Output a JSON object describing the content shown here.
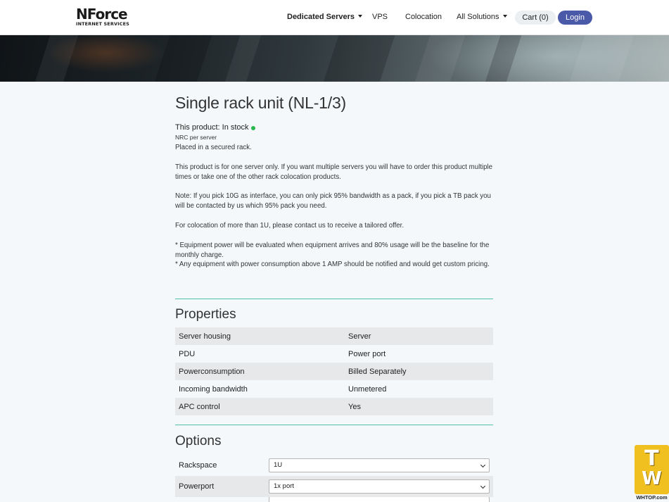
{
  "header": {
    "logo_main": "NForce",
    "logo_sub": "INTERNET SERVICES",
    "nav": [
      {
        "label": "Dedicated Servers",
        "has_dropdown": true
      },
      {
        "label": "VPS",
        "has_dropdown": false
      },
      {
        "label": "Colocation",
        "has_dropdown": false
      },
      {
        "label": "All Solutions",
        "has_dropdown": true
      }
    ],
    "cart_label": "Cart (0)",
    "login_label": "Login"
  },
  "product": {
    "title": "Single rack unit (NL-1/3)",
    "stock_label": "This product: In stock",
    "stock_status_color": "#28b84b",
    "nrc": "NRC per server",
    "paragraphs": [
      "Placed in a secured rack.",
      "This product is for one server only. If you want multiple servers you will have to order this product multiple times or take one of the other rack colocation products.",
      "Note: If you pick 10G as interface, you can only pick 95% bandwidth as a pack, if you pick a TB pack you will be contacted by us which 95% pack you need.",
      "For colocation of more than 1U, please contact us to receive a tailored offer.",
      "* Equipment power will be evaluated when equipment arrives and 80% usage will be the baseline for the monthly charge.",
      "* Any equipment with power consumption above 1 AMP should be notified and would get custom pricing."
    ]
  },
  "properties": {
    "heading": "Properties",
    "rows": [
      {
        "key": "Server housing",
        "value": "Server"
      },
      {
        "key": "PDU",
        "value": "Power port"
      },
      {
        "key": "Powerconsumption",
        "value": "Billed Separately"
      },
      {
        "key": "Incoming bandwidth",
        "value": "Unmetered"
      },
      {
        "key": "APC control",
        "value": "Yes"
      }
    ]
  },
  "options": {
    "heading": "Options",
    "rows": [
      {
        "label": "Rackspace",
        "selected": "1U"
      },
      {
        "label": "Powerport",
        "selected": "1x port"
      }
    ]
  },
  "watermark": {
    "letters_top": "T",
    "letters_bottom": "W",
    "url": "WHTOP.com"
  },
  "colors": {
    "accent_rule": "#4ec2a9",
    "login_button": "#4b5aa8"
  }
}
